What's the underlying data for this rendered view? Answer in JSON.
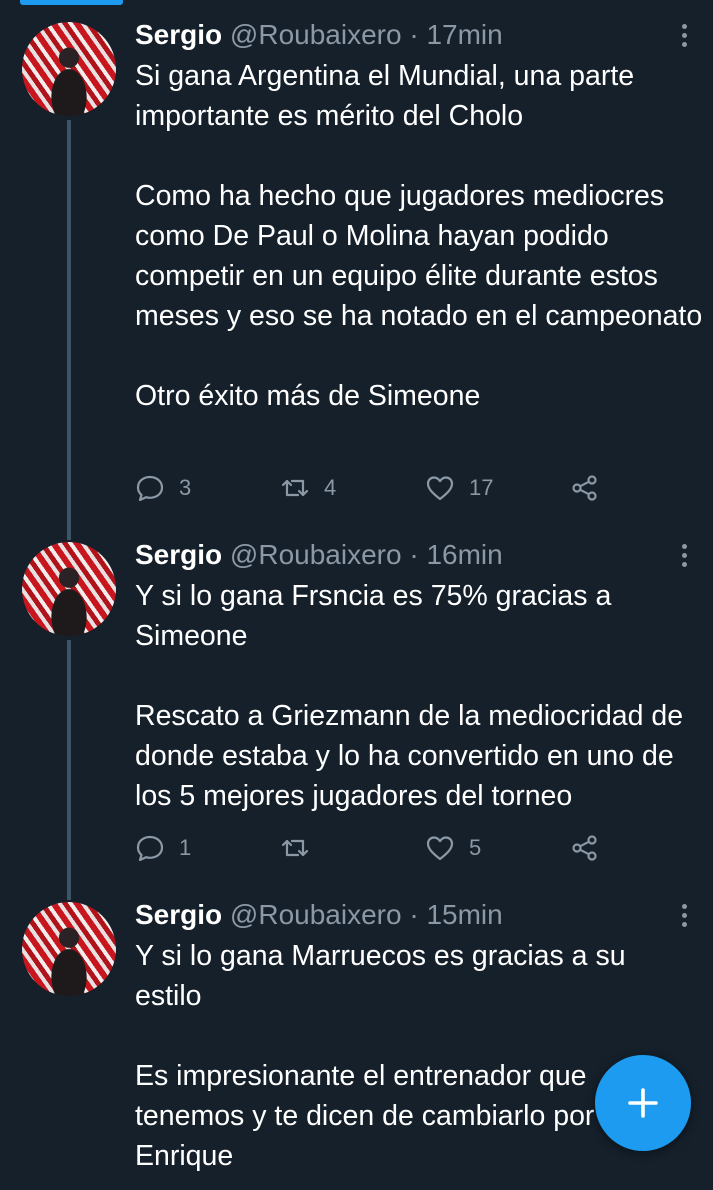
{
  "tweets": [
    {
      "name": "Sergio",
      "handle": "@Roubaixero",
      "sep": " · ",
      "time": "17min",
      "text": "Si gana Argentina el Mundial, una parte importante es mérito del Cholo\n\nComo ha hecho que jugadores mediocres como De Paul o Molina hayan podido competir en un equipo élite durante estos meses y eso se ha notado en el campeonato\n\nOtro éxito más de Simeone",
      "replies": "3",
      "retweets": "4",
      "likes": "17"
    },
    {
      "name": "Sergio",
      "handle": "@Roubaixero",
      "sep": " · ",
      "time": "16min",
      "text": "Y si lo gana Frsncia es 75% gracias a Simeone\n\nRescato a Griezmann de la mediocridad de donde estaba y lo ha convertido en uno de los 5 mejores jugadores del torneo",
      "replies": "1",
      "retweets": "",
      "likes": "5"
    },
    {
      "name": "Sergio",
      "handle": "@Roubaixero",
      "sep": " · ",
      "time": "15min",
      "text": "Y si lo gana Marruecos es gracias a su estilo\n\nEs impresionante el entrenador que tenemos y te dicen de cambiarlo por Enrique"
    }
  ],
  "colors": {
    "background": "#15202b",
    "accent": "#1d9bf0",
    "secondary_text": "#8b98a5",
    "thread_line": "#3d5466"
  },
  "icons": {
    "reply": "speech-bubble-icon",
    "retweet": "retweet-arrows-icon",
    "like": "heart-icon",
    "share": "share-nodes-icon",
    "more": "vertical-dots-icon",
    "compose": "plus-icon"
  }
}
